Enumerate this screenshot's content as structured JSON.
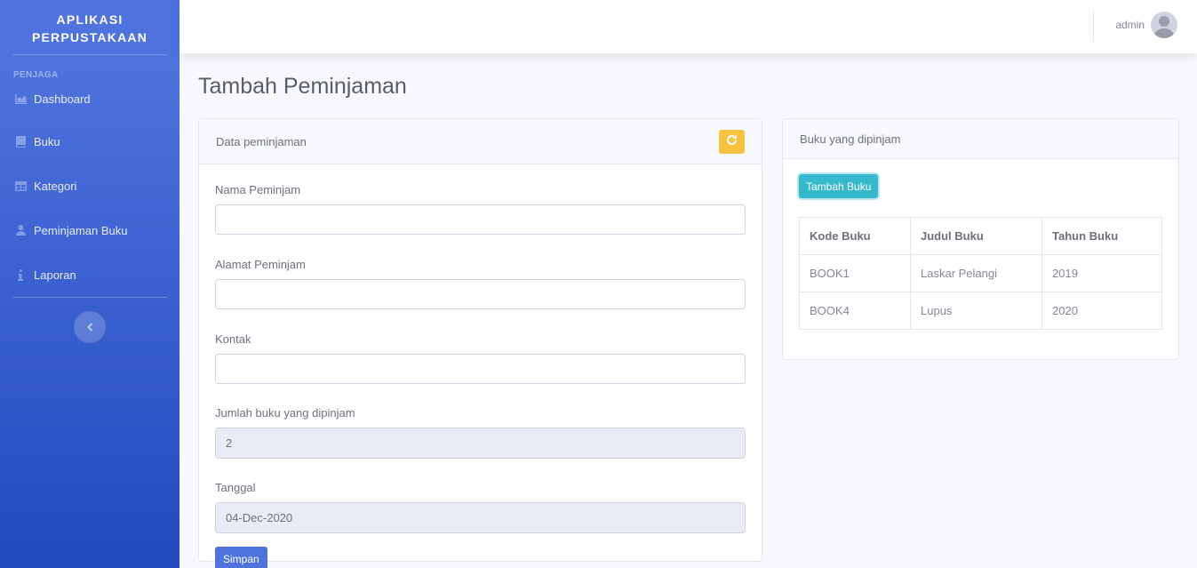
{
  "app": {
    "brand_line1": "APLIKASI",
    "brand_line2": "PERPUSTAKAAN"
  },
  "sidebar": {
    "heading": "PENJAGA",
    "items": [
      {
        "label": "Dashboard",
        "icon": "chart-area-icon"
      },
      {
        "label": "Buku",
        "icon": "book-icon"
      },
      {
        "label": "Kategori",
        "icon": "table-icon"
      },
      {
        "label": "Peminjaman Buku",
        "icon": "user-icon"
      },
      {
        "label": "Laporan",
        "icon": "info-icon"
      }
    ],
    "toggle_icon": "chevron-left-icon"
  },
  "topbar": {
    "username": "admin"
  },
  "page": {
    "title": "Tambah Peminjaman"
  },
  "form_card": {
    "header": "Data peminjaman",
    "fields": {
      "nama": {
        "label": "Nama Peminjam",
        "value": ""
      },
      "alamat": {
        "label": "Alamat Peminjam",
        "value": ""
      },
      "kontak": {
        "label": "Kontak",
        "value": ""
      },
      "jumlah": {
        "label": "Jumlah buku yang dipinjam",
        "value": "2"
      },
      "tanggal": {
        "label": "Tanggal",
        "value": "04-Dec-2020"
      }
    },
    "submit_label": "Simpan"
  },
  "books_card": {
    "header": "Buku yang dipinjam",
    "add_label": "Tambah Buku",
    "columns": [
      "Kode Buku",
      "Judul Buku",
      "Tahun Buku"
    ],
    "rows": [
      [
        "BOOK1",
        "Laskar Pelangi",
        "2019"
      ],
      [
        "BOOK4",
        "Lupus",
        "2020"
      ]
    ]
  },
  "colors": {
    "primary": "#4e73df",
    "warning": "#f6c23e",
    "info": "#36b9cc",
    "sidebar_gradient_end": "#224abe"
  }
}
